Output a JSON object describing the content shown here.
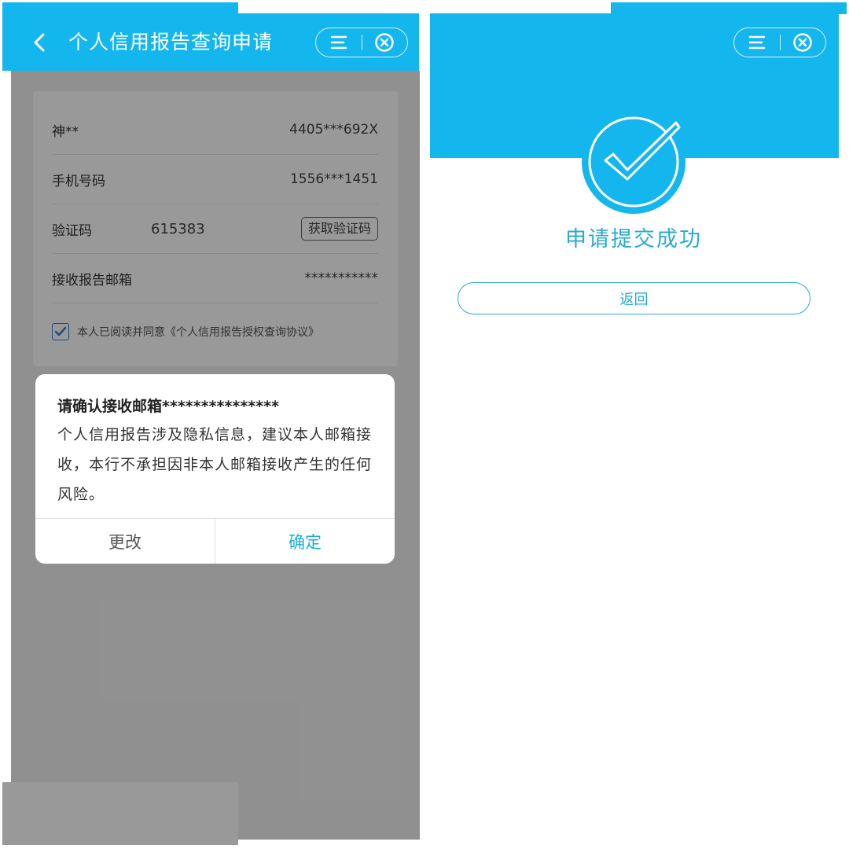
{
  "left": {
    "header": {
      "title": "个人信用报告查询申请",
      "back_icon": "chevron-left-icon",
      "menu_icon": "menu-icon",
      "close_icon": "close-circle-icon"
    },
    "form": {
      "name": {
        "label": "神**",
        "value": "4405***692X"
      },
      "phone": {
        "label": "手机号码",
        "value": "1556***1451"
      },
      "verify": {
        "label": "验证码",
        "value": "615383",
        "button": "获取验证码"
      },
      "email": {
        "label": "接收报告邮箱",
        "value": "***********"
      },
      "agreement": {
        "checked": true,
        "text": "本人已阅读并同意《个人信用报告授权查询协议》"
      }
    },
    "dialog": {
      "title": "请确认接收邮箱***************",
      "message": "个人信用报告涉及隐私信息，建议本人邮箱接收，本行不承担因非本人邮箱接收产生的任何风险。",
      "cancel": "更改",
      "confirm": "确定"
    }
  },
  "right": {
    "header": {
      "menu_icon": "menu-icon",
      "close_icon": "close-circle-icon"
    },
    "success_icon": "check-circle-icon",
    "success_text": "申请提交成功",
    "return_button": "返回"
  },
  "colors": {
    "brand": "#14b6ee",
    "accent_text": "#27abd3",
    "checkbox": "#2e7fd6"
  }
}
